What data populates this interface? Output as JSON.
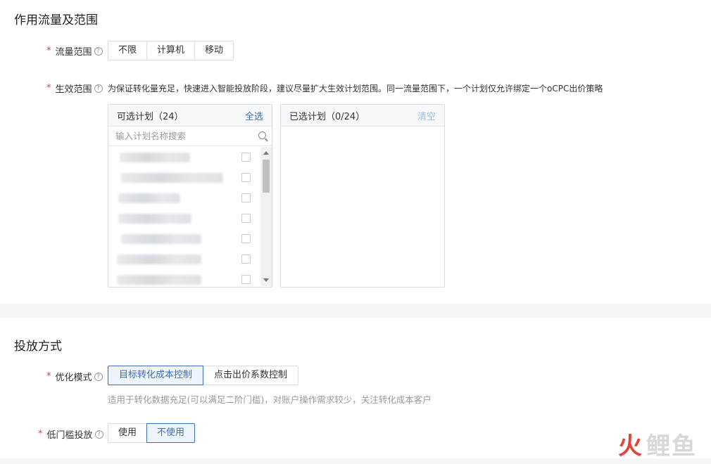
{
  "section1": {
    "title": "作用流量及范围",
    "traffic_scope": {
      "label": "流量范围",
      "required_mark": "*",
      "options": [
        "不限",
        "计算机",
        "移动"
      ]
    },
    "effect_scope": {
      "label": "生效范围",
      "required_mark": "*",
      "description": "为保证转化量充足，快速进入智能投放阶段，建议尽量扩大生效计划范围。同一流量范围下，一个计划仅允许绑定一个oCPC出价策略"
    },
    "available_panel": {
      "title": "可选计划（24）",
      "select_all": "全选",
      "search_placeholder": "输入计划名称搜索"
    },
    "selected_panel": {
      "title": "已选计划（0/24）",
      "clear": "清空"
    }
  },
  "section2": {
    "title": "投放方式",
    "optimize_mode": {
      "label": "优化模式",
      "required_mark": "*",
      "options": [
        "目标转化成本控制",
        "点击出价系数控制"
      ],
      "selected": "目标转化成本控制",
      "hint": "适用于转化数据充足(可以满足二阶门槛)，对账户操作需求较少，关注转化成本客户"
    },
    "low_threshold": {
      "label": "低门槛投放",
      "required_mark": "*",
      "options": [
        "使用",
        "不使用"
      ],
      "selected": "不使用"
    }
  },
  "watermark": {
    "text": "火鲤鱼"
  },
  "colors": {
    "accent": "#3d6fb0",
    "required": "#e4393c",
    "hint_text": "#999999"
  }
}
